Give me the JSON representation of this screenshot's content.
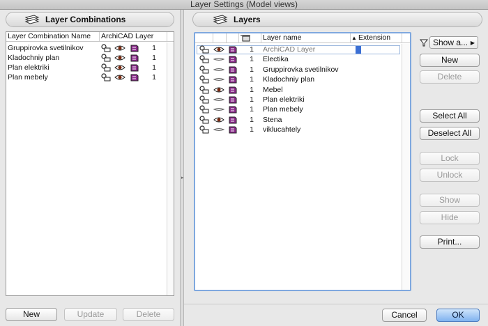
{
  "window": {
    "title": "Layer Settings (Model views)"
  },
  "left_panel": {
    "header": "Layer Combinations",
    "columns": {
      "name": "Layer Combination Name",
      "layer": "ArchiCAD Layer"
    },
    "rows": [
      {
        "name": "Gruppirovka svetilnikov",
        "count": "1"
      },
      {
        "name": "Kladochniy plan",
        "count": "1"
      },
      {
        "name": "Plan elektriki",
        "count": "1"
      },
      {
        "name": "Plan mebely",
        "count": "1"
      }
    ],
    "buttons": {
      "new": "New",
      "update": "Update",
      "delete": "Delete"
    }
  },
  "right_panel": {
    "header": "Layers",
    "columns": {
      "name": "Layer name",
      "extension": "Extension",
      "sort_indicator": "▲"
    },
    "rows": [
      {
        "count": "1",
        "name": "ArchiCAD Layer",
        "visible": true
      },
      {
        "count": "1",
        "name": "Electika",
        "visible": false
      },
      {
        "count": "1",
        "name": "Gruppirovka svetilnikov",
        "visible": false
      },
      {
        "count": "1",
        "name": "Kladochniy plan",
        "visible": false
      },
      {
        "count": "1",
        "name": "Mebel",
        "visible": true
      },
      {
        "count": "1",
        "name": "Plan elektriki",
        "visible": false
      },
      {
        "count": "1",
        "name": "Plan mebely",
        "visible": false
      },
      {
        "count": "1",
        "name": "Stena",
        "visible": true
      },
      {
        "count": "1",
        "name": "viklucahtely",
        "visible": false
      }
    ],
    "show_dropdown": "Show a...",
    "buttons": {
      "new": "New",
      "delete": "Delete",
      "select_all": "Select All",
      "deselect_all": "Deselect All",
      "lock": "Lock",
      "unlock": "Unlock",
      "show": "Show",
      "hide": "Hide",
      "print": "Print..."
    }
  },
  "dialog_buttons": {
    "cancel": "Cancel",
    "ok": "OK"
  },
  "colors": {
    "accent": "#3b6fd4",
    "focus_ring": "#7fa8df",
    "layer_color": "#8a2a8a"
  }
}
